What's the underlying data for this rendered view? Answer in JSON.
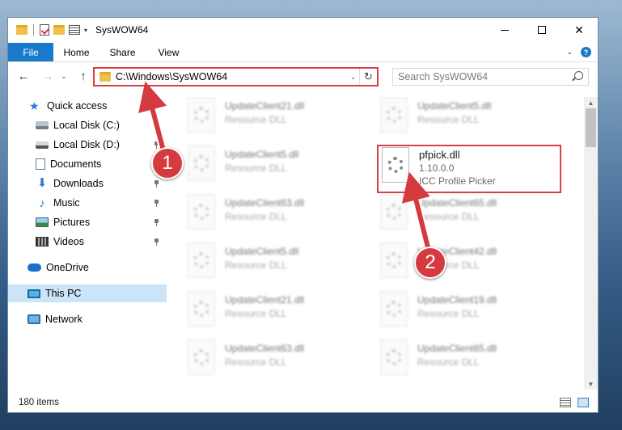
{
  "window": {
    "title": "SysWOW64",
    "controls": {
      "minimize": "",
      "maximize": "",
      "close": "✕"
    }
  },
  "ribbon": {
    "tabs": [
      "File",
      "Home",
      "Share",
      "View"
    ],
    "expand_glyph": "⌄",
    "help_glyph": "?"
  },
  "address": {
    "path": "C:\\Windows\\SysWOW64",
    "dropdown_glyph": "⌄",
    "refresh_glyph": "↻"
  },
  "nav_buttons": {
    "back": "←",
    "forward": "→",
    "recent": "⌄",
    "up": "↑"
  },
  "search": {
    "placeholder": "Search SysWOW64"
  },
  "sidebar": {
    "items": [
      {
        "label": "Quick access",
        "icon": "star-icon",
        "pinned": false
      },
      {
        "label": "Local Disk (C:)",
        "icon": "drive-icon",
        "pinned": true
      },
      {
        "label": "Local Disk (D:)",
        "icon": "drive-icon",
        "pinned": true
      },
      {
        "label": "Documents",
        "icon": "documents-icon",
        "pinned": true
      },
      {
        "label": "Downloads",
        "icon": "download-icon",
        "pinned": true
      },
      {
        "label": "Music",
        "icon": "music-icon",
        "pinned": true
      },
      {
        "label": "Pictures",
        "icon": "pictures-icon",
        "pinned": true
      },
      {
        "label": "Videos",
        "icon": "videos-icon",
        "pinned": true
      },
      {
        "label": "OneDrive",
        "icon": "cloud-icon",
        "pinned": false
      },
      {
        "label": "This PC",
        "icon": "computer-icon",
        "pinned": false,
        "selected": true
      },
      {
        "label": "Network",
        "icon": "network-icon",
        "pinned": false
      }
    ]
  },
  "files": {
    "left_column": [
      {
        "name": "UpdateClient21.dll",
        "desc": "Resource DLL"
      },
      {
        "name": "UpdateClient5.dll",
        "desc": "Resource DLL"
      },
      {
        "name": "UpdateClient63.dll",
        "desc": "Resource DLL"
      },
      {
        "name": "UpdateClient5.dll",
        "desc": "Resource DLL"
      },
      {
        "name": "UpdateClient21.dll",
        "desc": "Resource DLL"
      },
      {
        "name": "UpdateClient63.dll",
        "desc": "Resource DLL"
      }
    ],
    "right_column": [
      {
        "name": "UpdateClient5.dll",
        "desc": "Resource DLL"
      },
      {
        "name": "pfpick.dll",
        "version": "1.10.0.0",
        "desc": "ICC Profile Picker",
        "highlighted": true
      },
      {
        "name": "UpdateClient65.dll",
        "desc": "Resource DLL"
      },
      {
        "name": "UpdateClient42.dll",
        "desc": "Resource DLL"
      },
      {
        "name": "UpdateClient19.dll",
        "desc": "Resource DLL"
      },
      {
        "name": "UpdateClient65.dll",
        "desc": "Resource DLL"
      }
    ]
  },
  "scrollbar": {
    "up": "▲",
    "down": "▼"
  },
  "status": {
    "item_count": "180 items"
  },
  "annotations": {
    "step1": "1",
    "step2": "2"
  },
  "colors": {
    "accent": "#1979ca",
    "annotation_red": "#d53b3e",
    "selected_bg": "#cce4f7"
  }
}
